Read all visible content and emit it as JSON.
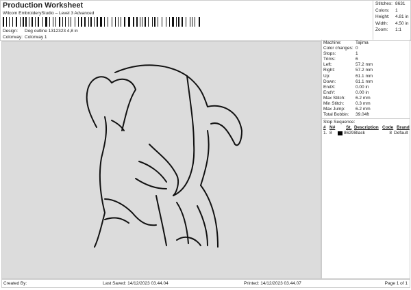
{
  "header": {
    "title": "Production Worksheet",
    "subtitle": "Wilcom EmbroideryStudio – Level 3 Advanced",
    "design_label": "Design:",
    "design_value": "Dog outline 1312323 4,8 in",
    "colorway_label": "Colorway:",
    "colorway_value": "Colorway 1"
  },
  "stats": [
    {
      "label": "Stitches:",
      "value": "8631"
    },
    {
      "label": "Colors:",
      "value": "1"
    },
    {
      "label": "Height:",
      "value": "4.81 in"
    },
    {
      "label": "Width:",
      "value": "4.50 in"
    },
    {
      "label": "Zoom:",
      "value": "1:1"
    }
  ],
  "machine": [
    {
      "label": "Machine:",
      "value": "Tajima"
    },
    {
      "label": "Color changes:",
      "value": "0"
    },
    {
      "label": "Stops:",
      "value": "1"
    },
    {
      "label": "Trims:",
      "value": "6"
    },
    {
      "label": "Left:",
      "value": "57.2 mm"
    },
    {
      "label": "Right:",
      "value": "57.2 mm"
    },
    {
      "label": "Up:",
      "value": "61.1 mm"
    },
    {
      "label": "Down:",
      "value": "61.1 mm"
    },
    {
      "label": "EndX:",
      "value": "0.00 in"
    },
    {
      "label": "EndY:",
      "value": "0.00 in"
    },
    {
      "label": "Max Stitch:",
      "value": "6.2 mm"
    },
    {
      "label": "Min Stitch:",
      "value": "0.3 mm"
    },
    {
      "label": "Max Jump:",
      "value": "6.2 mm"
    },
    {
      "label": "Total Bobbin:",
      "value": "39.04ft"
    }
  ],
  "stop_sequence": {
    "title": "Stop Sequence:",
    "headers": [
      "#",
      "N#",
      "St.",
      "Description",
      "Code",
      "Brand"
    ],
    "rows": [
      {
        "num": "1.",
        "n": "8",
        "color": "#000000",
        "st": "8629",
        "desc": "Black",
        "code": "8",
        "brand": "Default"
      }
    ]
  },
  "footer": {
    "created": "Created By:",
    "saved": "Last Saved: 14/12/2023 03.44.04",
    "printed": "Printed: 14/12/2023 03.44.07",
    "page": "Page 1 of 1"
  }
}
